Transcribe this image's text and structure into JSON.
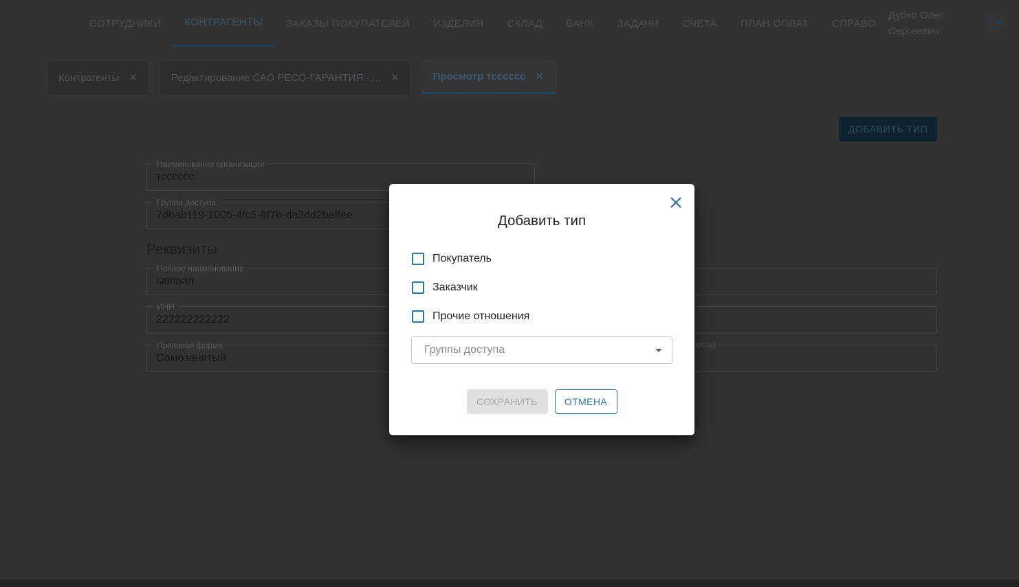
{
  "header": {
    "nav": [
      {
        "label": "СОТРУДНИКИ",
        "active": false
      },
      {
        "label": "КОНТРАГЕНТЫ",
        "active": true
      },
      {
        "label": "ЗАКАЗЫ ПОКУПАТЕЛЕЙ",
        "active": false
      },
      {
        "label": "ИЗДЕЛИЯ",
        "active": false
      },
      {
        "label": "СКЛАД",
        "active": false
      },
      {
        "label": "БАНК",
        "active": false
      },
      {
        "label": "ЗАДАЧИ",
        "active": false
      },
      {
        "label": "СЧЕТА",
        "active": false
      },
      {
        "label": "ПЛАН ОПЛАТ",
        "active": false
      },
      {
        "label": "СПРАВО",
        "active": false
      }
    ],
    "user": {
      "line1": "Дубко Олег",
      "line2": "Сергеевич"
    },
    "icons": {
      "logout": "logout-icon"
    }
  },
  "tabs": [
    {
      "label": "Контрагенты",
      "active": false,
      "close_icon": "✕"
    },
    {
      "label": "Редактирование САО РЕСО-ГАРАНТИЯ - ...",
      "active": false,
      "close_icon": "✕"
    },
    {
      "label": "Просмотр тсссссс",
      "active": true,
      "close_icon": "✕"
    }
  ],
  "content": {
    "add_type_button": "ДОБАВИТЬ ТИП",
    "org_name_field": {
      "label": "Наименование организации",
      "value": "тсссссс"
    },
    "access_group_field": {
      "label": "Группа доступа",
      "value": "7dbab119-1005-4fc5-8f7b-da3dd2beffee"
    },
    "section_title": "Реквизиты",
    "full_name_field": {
      "label": "Полное наименование",
      "value": "ывпвап"
    },
    "inn_field": {
      "label": "ИНН",
      "value": "222222222222"
    },
    "legal_form_field": {
      "label": "Правовая форма",
      "value": "Самозанятый"
    },
    "right_field_label_fragment": "ность)"
  },
  "modal": {
    "title": "Добавить тип",
    "close_icon": "✕",
    "checkboxes": [
      {
        "label": "Покупатель",
        "checked": false
      },
      {
        "label": "Заказчик",
        "checked": false
      },
      {
        "label": "Прочие отношения",
        "checked": false
      }
    ],
    "access_groups_select": {
      "placeholder": "Группы доступа",
      "icon": "chevron-down-icon"
    },
    "save_button": {
      "label": "СОХРАНИТЬ",
      "disabled": true
    },
    "cancel_button": {
      "label": "ОТМЕНА"
    }
  },
  "colors": {
    "primary_blue": "#30749E",
    "dimmed_page_bg": "#323232",
    "modal_bg": "#FFFFFF",
    "disabled_button_bg": "#E0E0E0",
    "disabled_button_text": "#A5A5A5",
    "active_tab_underline": "#1E4258",
    "footer_bar": "#232323"
  }
}
